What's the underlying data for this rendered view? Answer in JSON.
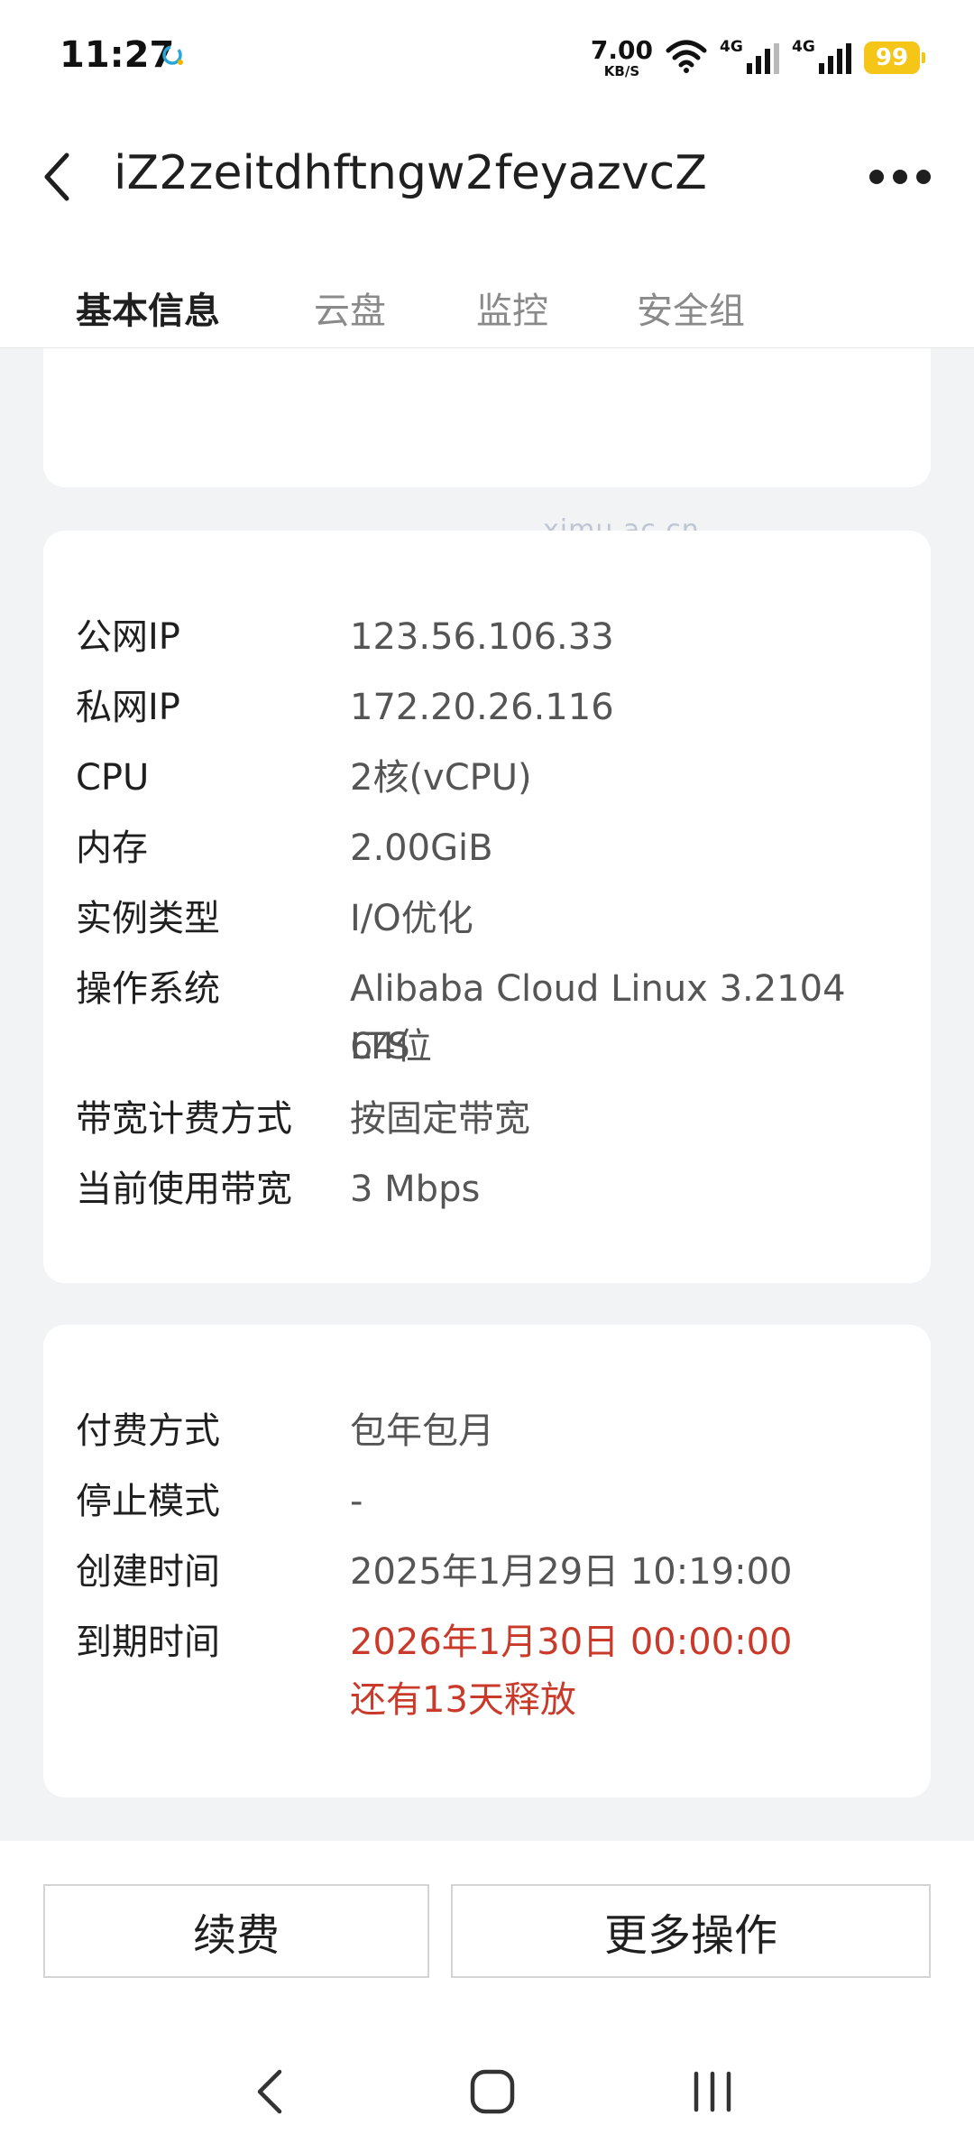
{
  "status_bar": {
    "time": "11:27",
    "net_speed_value": "7.00",
    "net_speed_unit": "KB/S",
    "signal_1_label": "4G",
    "signal_2_label": "4G",
    "battery": "99",
    "icons": [
      "chat-bubble-icon",
      "wifi-icon",
      "signal-icon",
      "battery-icon"
    ]
  },
  "header": {
    "title": "iZ2zeitdhftngw2feyazvcZ",
    "tabs": [
      {
        "label": "基本信息",
        "active": true
      },
      {
        "label": "云盘",
        "active": false
      },
      {
        "label": "监控",
        "active": false
      },
      {
        "label": "安全组",
        "active": false
      }
    ],
    "accent_color": "#1a6fe6"
  },
  "watermark": "xjmu.ac.cn",
  "network_info": [
    {
      "label": "公网IP",
      "value": "123.56.106.33"
    },
    {
      "label": "私网IP",
      "value": "172.20.26.116"
    },
    {
      "label": "CPU",
      "value": "2核(vCPU)"
    },
    {
      "label": "内存",
      "value": "2.00GiB"
    },
    {
      "label": "实例类型",
      "value": "I/O优化"
    },
    {
      "label": "操作系统",
      "value_line1": "Alibaba Cloud Linux 3.2104 LTS",
      "value_line2": "64位"
    },
    {
      "label": "带宽计费方式",
      "value": "按固定带宽"
    },
    {
      "label": "当前使用带宽",
      "value": "3 Mbps"
    }
  ],
  "billing_info": [
    {
      "label": "付费方式",
      "value": "包年包月"
    },
    {
      "label": "停止模式",
      "value": "-"
    },
    {
      "label": "创建时间",
      "value": "2025年1月29日 10:19:00"
    },
    {
      "label": "到期时间",
      "value": "2026年1月30日 00:00:00",
      "note": "还有13天释放"
    }
  ],
  "expiry_color": "#c93a2b",
  "actions": {
    "renew_label": "续费",
    "more_label": "更多操作"
  }
}
